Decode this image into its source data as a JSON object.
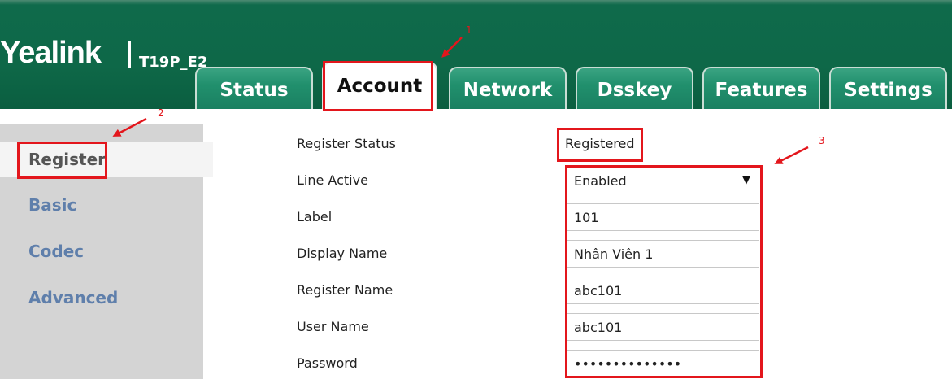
{
  "header": {
    "brand": "Yealink",
    "model": "T19P_E2",
    "tabs": [
      {
        "label": "Status",
        "active": false
      },
      {
        "label": "Account",
        "active": true
      },
      {
        "label": "Network",
        "active": false
      },
      {
        "label": "Dsskey",
        "active": false
      },
      {
        "label": "Features",
        "active": false
      },
      {
        "label": "Settings",
        "active": false
      }
    ]
  },
  "sidebar": {
    "items": [
      {
        "label": "Register",
        "active": true
      },
      {
        "label": "Basic",
        "active": false
      },
      {
        "label": "Codec",
        "active": false
      },
      {
        "label": "Advanced",
        "active": false
      }
    ]
  },
  "form": {
    "register_status": {
      "label": "Register Status",
      "value": "Registered"
    },
    "line_active": {
      "label": "Line Active",
      "value": "Enabled",
      "caret": "▼"
    },
    "label": {
      "label": "Label",
      "value": "101"
    },
    "display_name": {
      "label": "Display Name",
      "value": "Nhân Viên 1"
    },
    "register_name": {
      "label": "Register Name",
      "value": "abc101"
    },
    "user_name": {
      "label": "User Name",
      "value": "abc101"
    },
    "password": {
      "label": "Password",
      "value": "••••••••••••••"
    }
  },
  "annotations": {
    "numbers": [
      "1",
      "2",
      "3"
    ],
    "color": "#e3161c"
  },
  "colors": {
    "header_green": "#0e6848",
    "tab_green": "#21906d",
    "sidebar_bg": "#d4d4d4",
    "sidebar_link": "#5f7fab"
  }
}
